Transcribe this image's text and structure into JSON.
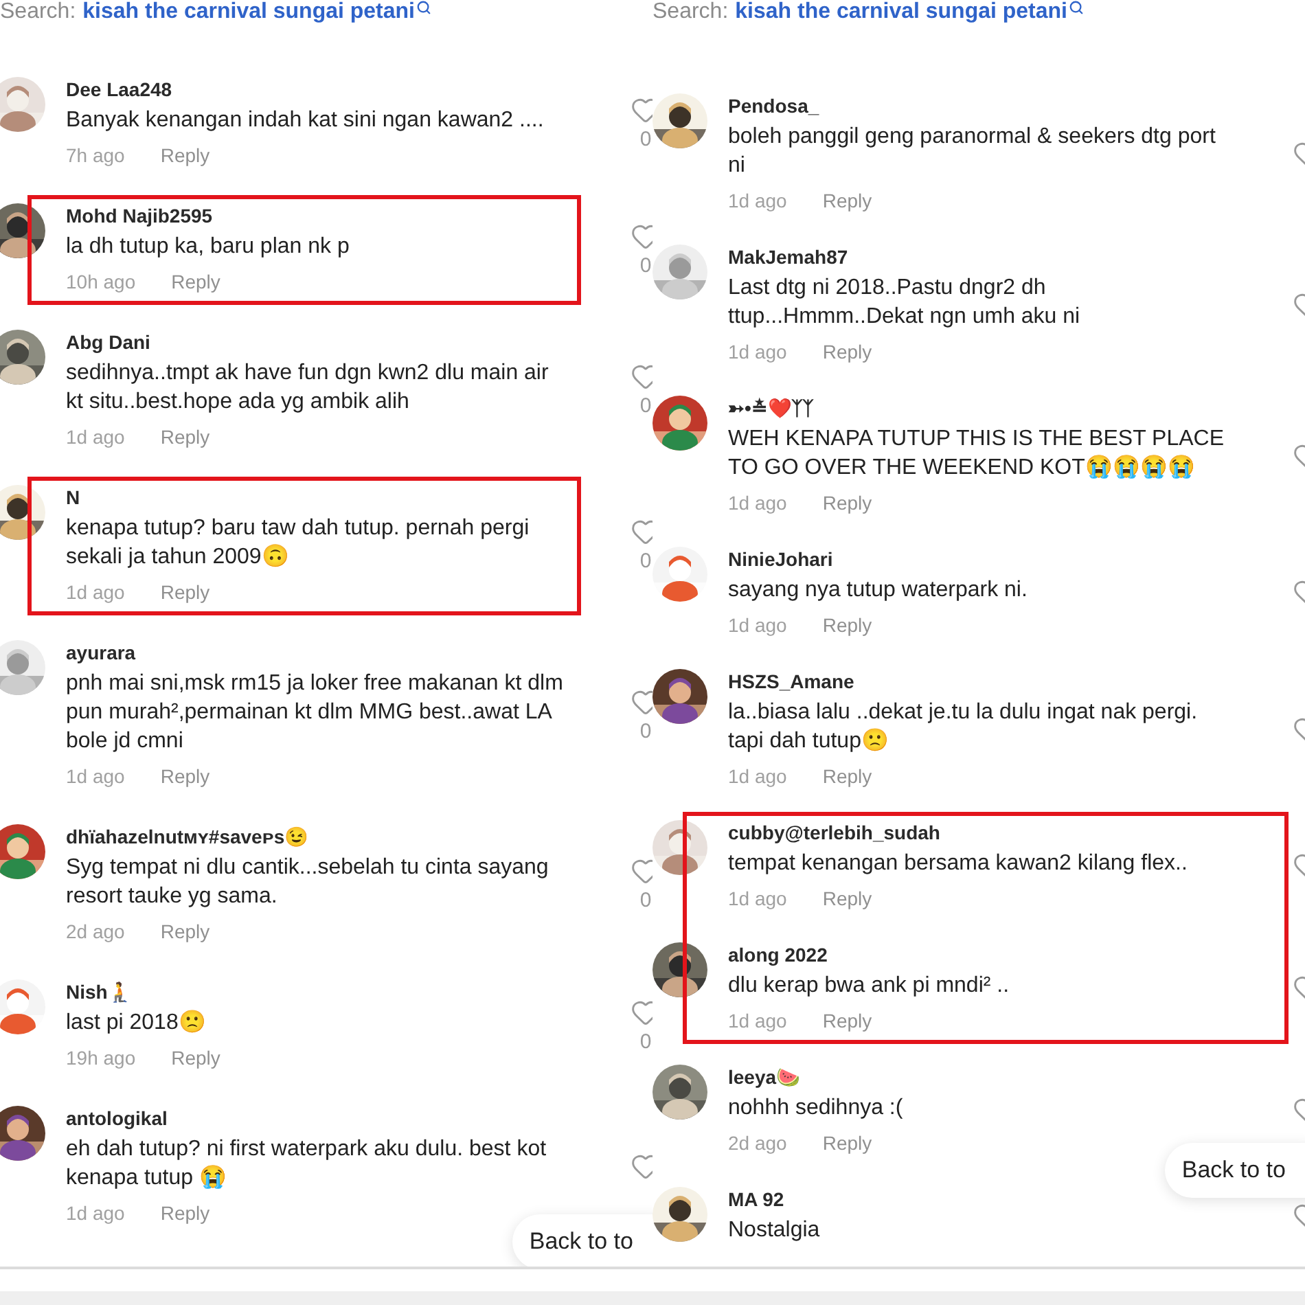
{
  "panels": [
    {
      "search": {
        "label": "Search:",
        "query": "kisah the carnival sungai petani"
      },
      "blocks": [
        {
          "highlighted": false,
          "comments": [
            {
              "user": "Dee Laa248",
              "text": "Banyak kenangan indah kat sini ngan kawan2 ....",
              "time": "7h ago",
              "reply": "Reply",
              "likes": "0"
            }
          ]
        },
        {
          "highlighted": true,
          "comments": [
            {
              "user": "Mohd Najib2595",
              "text": "la dh tutup ka, baru plan nk p",
              "time": "10h ago",
              "reply": "Reply",
              "likes": "0"
            }
          ]
        },
        {
          "highlighted": false,
          "comments": [
            {
              "user": "Abg Dani",
              "text": "sedihnya..tmpt ak have fun dgn kwn2 dlu main air kt situ..best.hope ada yg ambik alih",
              "time": "1d ago",
              "reply": "Reply",
              "likes": "0"
            }
          ]
        },
        {
          "highlighted": true,
          "comments": [
            {
              "user": "N",
              "text": "kenapa tutup? baru taw dah tutup. pernah pergi sekali ja tahun 2009🙃",
              "time": "1d ago",
              "reply": "Reply",
              "likes": "0"
            }
          ]
        },
        {
          "highlighted": false,
          "comments": [
            {
              "user": "ayurara",
              "text": "pnh mai sni,msk rm15 ja loker free makanan kt dlm pun murah²,permainan kt dlm MMG best..awat LA bole jd cmni",
              "time": "1d ago",
              "reply": "Reply",
              "likes": "0"
            }
          ]
        },
        {
          "highlighted": false,
          "comments": [
            {
              "user": "dhïahazelnutᴍʏ#saveᴘs😉",
              "text": "Syg tempat ni dlu cantik...sebelah tu cinta sayang resort tauke yg sama.",
              "time": "2d ago",
              "reply": "Reply",
              "likes": "0"
            }
          ]
        },
        {
          "highlighted": false,
          "comments": [
            {
              "user": "Nish🧎",
              "text": "last pi 2018🙁",
              "time": "19h ago",
              "reply": "Reply",
              "likes": "0"
            }
          ]
        },
        {
          "highlighted": false,
          "comments": [
            {
              "user": "antologikal",
              "text": "eh dah tutup? ni first waterpark aku dulu. best kot kenapa tutup 😭",
              "time": "1d ago",
              "reply": "Reply"
            }
          ]
        }
      ],
      "back_to_top": "Back to to"
    },
    {
      "search": {
        "label": "Search:",
        "query": "kisah the carnival sungai petani"
      },
      "blocks": [
        {
          "highlighted": false,
          "comments": [
            {
              "user": "Pendosa_",
              "text": "boleh panggil geng paranormal & seekers dtg port ni",
              "time": "1d ago",
              "reply": "Reply"
            }
          ]
        },
        {
          "highlighted": false,
          "comments": [
            {
              "user": "MakJemah87",
              "text": "Last dtg ni 2018..Pastu dngr2 dh ttup...Hmmm..Dekat ngn umh aku ni",
              "time": "1d ago",
              "reply": "Reply"
            }
          ]
        },
        {
          "highlighted": false,
          "comments": [
            {
              "user": "➳•≛❤️ᛉᛉ",
              "text": "WEH KENAPA TUTUP THIS IS THE BEST PLACE TO GO OVER THE WEEKEND KOT😭😭😭😭",
              "time": "1d ago",
              "reply": "Reply"
            }
          ]
        },
        {
          "highlighted": false,
          "comments": [
            {
              "user": "NinieJohari",
              "text": "sayang nya tutup waterpark ni.",
              "time": "1d ago",
              "reply": "Reply"
            }
          ]
        },
        {
          "highlighted": false,
          "comments": [
            {
              "user": "HSZS_Amane",
              "text": "la..biasa lalu ..dekat je.tu la dulu ingat nak pergi. tapi dah tutup🙁",
              "time": "1d ago",
              "reply": "Reply"
            }
          ]
        },
        {
          "highlighted": true,
          "comments": [
            {
              "user": "cubby@terlebih_sudah",
              "text": "tempat kenangan bersama kawan2 kilang flex..",
              "time": "1d ago",
              "reply": "Reply"
            },
            {
              "user": "along 2022",
              "text": "dlu kerap bwa ank pi mndi² ..",
              "time": "1d ago",
              "reply": "Reply"
            }
          ]
        },
        {
          "highlighted": false,
          "comments": [
            {
              "user": "leeya🍉",
              "text": "nohhh sedihnya :(",
              "time": "2d ago",
              "reply": "Reply"
            }
          ]
        },
        {
          "highlighted": false,
          "comments": [
            {
              "user": "MA 92",
              "text": "Nostalgia"
            }
          ]
        }
      ],
      "back_to_top": "Back to to"
    }
  ]
}
